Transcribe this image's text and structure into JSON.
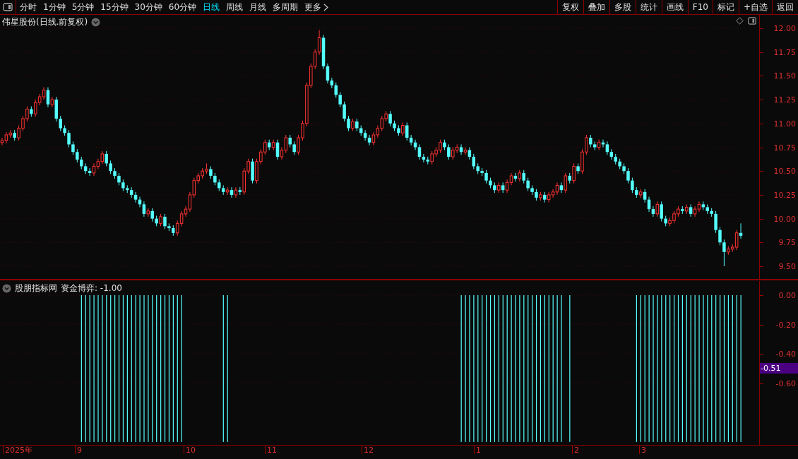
{
  "toolbar": {
    "periods": [
      {
        "label": "分时",
        "selected": false
      },
      {
        "label": "1分钟",
        "selected": false
      },
      {
        "label": "5分钟",
        "selected": false
      },
      {
        "label": "15分钟",
        "selected": false
      },
      {
        "label": "30分钟",
        "selected": false
      },
      {
        "label": "60分钟",
        "selected": false
      },
      {
        "label": "日线",
        "selected": true
      },
      {
        "label": "周线",
        "selected": false
      },
      {
        "label": "月线",
        "selected": false
      },
      {
        "label": "多周期",
        "selected": false
      }
    ],
    "more": "更多",
    "actions": [
      "复权",
      "叠加",
      "多股",
      "统计",
      "画线",
      "F10",
      "标记",
      "+自选",
      "返回"
    ]
  },
  "main_chart": {
    "title": "伟星股份(日线.前复权)",
    "chart_data": {
      "type": "candlestick",
      "grid": true,
      "ylim": [
        9.5,
        12
      ],
      "yticks": [
        {
          "value": 12,
          "label": "12.00"
        },
        {
          "value": 11.75,
          "label": "11.75"
        },
        {
          "value": 11.5,
          "label": "11.50"
        },
        {
          "value": 11.25,
          "label": "11.25"
        },
        {
          "value": 11,
          "label": "11.00"
        },
        {
          "value": 10.75,
          "label": "10.75"
        },
        {
          "value": 10.5,
          "label": "10.50"
        },
        {
          "value": 10.25,
          "label": "10.25"
        },
        {
          "value": 10,
          "label": "10.00"
        },
        {
          "value": 9.75,
          "label": "9.75"
        },
        {
          "value": 9.5,
          "label": "9.50"
        }
      ],
      "ohlc": [
        [
          10.8,
          10.85,
          10.77,
          10.82
        ],
        [
          10.82,
          10.91,
          10.79,
          10.88
        ],
        [
          10.88,
          10.93,
          10.85,
          10.9
        ],
        [
          10.9,
          10.93,
          10.82,
          10.85
        ],
        [
          10.85,
          10.98,
          10.82,
          10.95
        ],
        [
          10.95,
          11.08,
          10.92,
          11.05
        ],
        [
          11.05,
          11.18,
          11.02,
          11.15
        ],
        [
          11.15,
          11.18,
          11.07,
          11.1
        ],
        [
          11.1,
          11.25,
          11.07,
          11.22
        ],
        [
          11.22,
          11.31,
          11.19,
          11.28
        ],
        [
          11.28,
          11.38,
          11.25,
          11.35
        ],
        [
          11.35,
          11.38,
          11.17,
          11.2
        ],
        [
          11.2,
          11.28,
          11.17,
          11.25
        ],
        [
          11.25,
          11.28,
          11.02,
          11.05
        ],
        [
          11.05,
          11.08,
          10.92,
          10.95
        ],
        [
          10.95,
          10.98,
          10.87,
          10.9
        ],
        [
          10.9,
          10.93,
          10.75,
          10.78
        ],
        [
          10.78,
          10.81,
          10.67,
          10.7
        ],
        [
          10.7,
          10.73,
          10.59,
          10.62
        ],
        [
          10.62,
          10.65,
          10.52,
          10.55
        ],
        [
          10.55,
          10.58,
          10.47,
          10.5
        ],
        [
          10.5,
          10.53,
          10.45,
          10.48
        ],
        [
          10.48,
          10.58,
          10.45,
          10.55
        ],
        [
          10.55,
          10.63,
          10.52,
          10.6
        ],
        [
          10.6,
          10.71,
          10.57,
          10.68
        ],
        [
          10.68,
          10.71,
          10.55,
          10.58
        ],
        [
          10.58,
          10.61,
          10.47,
          10.5
        ],
        [
          10.5,
          10.53,
          10.42,
          10.45
        ],
        [
          10.45,
          10.48,
          10.35,
          10.38
        ],
        [
          10.38,
          10.41,
          10.29,
          10.32
        ],
        [
          10.32,
          10.35,
          10.27,
          10.3
        ],
        [
          10.3,
          10.33,
          10.22,
          10.25
        ],
        [
          10.25,
          10.28,
          10.17,
          10.2
        ],
        [
          10.2,
          10.23,
          10.12,
          10.15
        ],
        [
          10.15,
          10.18,
          10.02,
          10.05
        ],
        [
          10.05,
          10.11,
          10.02,
          10.08
        ],
        [
          10.08,
          10.11,
          9.97,
          10.0
        ],
        [
          10.0,
          10.03,
          9.92,
          9.95
        ],
        [
          9.95,
          10.05,
          9.92,
          10.02
        ],
        [
          10.02,
          10.05,
          9.89,
          9.92
        ],
        [
          9.92,
          9.95,
          9.87,
          9.9
        ],
        [
          9.9,
          9.93,
          9.82,
          9.85
        ],
        [
          9.85,
          9.98,
          9.82,
          9.95
        ],
        [
          9.95,
          10.08,
          9.92,
          10.05
        ],
        [
          10.05,
          10.13,
          10.02,
          10.1
        ],
        [
          10.1,
          10.28,
          10.07,
          10.25
        ],
        [
          10.25,
          10.43,
          10.22,
          10.4
        ],
        [
          10.4,
          10.48,
          10.37,
          10.45
        ],
        [
          10.45,
          10.53,
          10.42,
          10.5
        ],
        [
          10.5,
          10.58,
          10.47,
          10.52
        ],
        [
          10.52,
          10.55,
          10.42,
          10.45
        ],
        [
          10.45,
          10.48,
          10.35,
          10.38
        ],
        [
          10.38,
          10.41,
          10.29,
          10.32
        ],
        [
          10.32,
          10.35,
          10.25,
          10.28
        ],
        [
          10.28,
          10.33,
          10.25,
          10.3
        ],
        [
          10.3,
          10.33,
          10.22,
          10.25
        ],
        [
          10.25,
          10.33,
          10.22,
          10.3
        ],
        [
          10.3,
          10.33,
          10.25,
          10.28
        ],
        [
          10.28,
          10.53,
          10.25,
          10.5
        ],
        [
          10.5,
          10.63,
          10.47,
          10.6
        ],
        [
          10.6,
          10.63,
          10.37,
          10.4
        ],
        [
          10.4,
          10.63,
          10.37,
          10.6
        ],
        [
          10.6,
          10.73,
          10.57,
          10.7
        ],
        [
          10.7,
          10.83,
          10.67,
          10.8
        ],
        [
          10.8,
          10.83,
          10.72,
          10.75
        ],
        [
          10.75,
          10.83,
          10.72,
          10.8
        ],
        [
          10.8,
          10.83,
          10.62,
          10.65
        ],
        [
          10.65,
          10.75,
          10.62,
          10.72
        ],
        [
          10.72,
          10.88,
          10.69,
          10.85
        ],
        [
          10.85,
          10.88,
          10.75,
          10.78
        ],
        [
          10.78,
          10.81,
          10.67,
          10.7
        ],
        [
          10.7,
          10.88,
          10.67,
          10.85
        ],
        [
          10.85,
          11.03,
          10.82,
          11.0
        ],
        [
          11.0,
          11.43,
          10.97,
          11.4
        ],
        [
          11.4,
          11.63,
          11.37,
          11.6
        ],
        [
          11.6,
          11.78,
          11.57,
          11.75
        ],
        [
          11.75,
          11.98,
          11.72,
          11.9
        ],
        [
          11.9,
          11.93,
          11.57,
          11.6
        ],
        [
          11.6,
          11.63,
          11.42,
          11.45
        ],
        [
          11.45,
          11.48,
          11.37,
          11.4
        ],
        [
          11.4,
          11.43,
          11.27,
          11.3
        ],
        [
          11.3,
          11.33,
          11.17,
          11.2
        ],
        [
          11.2,
          11.23,
          11.02,
          11.05
        ],
        [
          11.05,
          11.08,
          10.92,
          10.95
        ],
        [
          10.95,
          11.05,
          10.92,
          11.02
        ],
        [
          11.02,
          11.05,
          10.92,
          10.95
        ],
        [
          10.95,
          10.98,
          10.87,
          10.9
        ],
        [
          10.9,
          10.93,
          10.82,
          10.85
        ],
        [
          10.85,
          10.88,
          10.77,
          10.8
        ],
        [
          10.8,
          10.91,
          10.77,
          10.88
        ],
        [
          10.88,
          10.98,
          10.85,
          10.95
        ],
        [
          10.95,
          11.08,
          10.92,
          11.05
        ],
        [
          11.05,
          11.13,
          11.02,
          11.1
        ],
        [
          11.1,
          11.13,
          10.97,
          11.0
        ],
        [
          11.0,
          11.03,
          10.92,
          10.95
        ],
        [
          10.95,
          10.98,
          10.87,
          10.9
        ],
        [
          10.9,
          11.01,
          10.87,
          10.98
        ],
        [
          10.98,
          11.01,
          10.82,
          10.85
        ],
        [
          10.85,
          10.88,
          10.77,
          10.8
        ],
        [
          10.8,
          10.83,
          10.72,
          10.75
        ],
        [
          10.75,
          10.78,
          10.62,
          10.65
        ],
        [
          10.65,
          10.68,
          10.59,
          10.62
        ],
        [
          10.62,
          10.65,
          10.57,
          10.6
        ],
        [
          10.6,
          10.71,
          10.57,
          10.68
        ],
        [
          10.68,
          10.75,
          10.65,
          10.72
        ],
        [
          10.72,
          10.83,
          10.69,
          10.8
        ],
        [
          10.8,
          10.83,
          10.72,
          10.75
        ],
        [
          10.75,
          10.78,
          10.62,
          10.65
        ],
        [
          10.65,
          10.75,
          10.62,
          10.72
        ],
        [
          10.72,
          10.78,
          10.69,
          10.75
        ],
        [
          10.75,
          10.78,
          10.67,
          10.7
        ],
        [
          10.7,
          10.75,
          10.67,
          10.72
        ],
        [
          10.72,
          10.75,
          10.62,
          10.65
        ],
        [
          10.65,
          10.68,
          10.52,
          10.55
        ],
        [
          10.55,
          10.58,
          10.47,
          10.5
        ],
        [
          10.5,
          10.53,
          10.45,
          10.48
        ],
        [
          10.48,
          10.51,
          10.37,
          10.4
        ],
        [
          10.4,
          10.43,
          10.32,
          10.35
        ],
        [
          10.35,
          10.38,
          10.27,
          10.3
        ],
        [
          10.3,
          10.38,
          10.27,
          10.35
        ],
        [
          10.35,
          10.38,
          10.27,
          10.3
        ],
        [
          10.3,
          10.41,
          10.27,
          10.38
        ],
        [
          10.38,
          10.48,
          10.35,
          10.45
        ],
        [
          10.45,
          10.48,
          10.39,
          10.42
        ],
        [
          10.42,
          10.51,
          10.39,
          10.48
        ],
        [
          10.48,
          10.51,
          10.37,
          10.4
        ],
        [
          10.4,
          10.43,
          10.29,
          10.32
        ],
        [
          10.32,
          10.35,
          10.25,
          10.28
        ],
        [
          10.28,
          10.31,
          10.19,
          10.22
        ],
        [
          10.22,
          10.28,
          10.19,
          10.25
        ],
        [
          10.25,
          10.28,
          10.17,
          10.2
        ],
        [
          10.2,
          10.28,
          10.17,
          10.25
        ],
        [
          10.25,
          10.31,
          10.22,
          10.28
        ],
        [
          10.28,
          10.38,
          10.25,
          10.35
        ],
        [
          10.35,
          10.38,
          10.27,
          10.3
        ],
        [
          10.3,
          10.48,
          10.27,
          10.45
        ],
        [
          10.45,
          10.48,
          10.37,
          10.4
        ],
        [
          10.4,
          10.58,
          10.37,
          10.55
        ],
        [
          10.55,
          10.58,
          10.47,
          10.5
        ],
        [
          10.5,
          10.73,
          10.47,
          10.7
        ],
        [
          10.7,
          10.88,
          10.67,
          10.85
        ],
        [
          10.85,
          10.88,
          10.75,
          10.78
        ],
        [
          10.78,
          10.81,
          10.72,
          10.75
        ],
        [
          10.75,
          10.83,
          10.72,
          10.8
        ],
        [
          10.8,
          10.83,
          10.75,
          10.78
        ],
        [
          10.78,
          10.81,
          10.67,
          10.7
        ],
        [
          10.7,
          10.73,
          10.62,
          10.65
        ],
        [
          10.65,
          10.68,
          10.57,
          10.6
        ],
        [
          10.6,
          10.63,
          10.52,
          10.55
        ],
        [
          10.55,
          10.58,
          10.47,
          10.5
        ],
        [
          10.5,
          10.53,
          10.37,
          10.4
        ],
        [
          10.4,
          10.43,
          10.27,
          10.3
        ],
        [
          10.3,
          10.33,
          10.22,
          10.25
        ],
        [
          10.25,
          10.31,
          10.22,
          10.28
        ],
        [
          10.28,
          10.31,
          10.17,
          10.2
        ],
        [
          10.2,
          10.23,
          10.07,
          10.1
        ],
        [
          10.1,
          10.13,
          10.02,
          10.05
        ],
        [
          10.05,
          10.18,
          10.02,
          10.15
        ],
        [
          10.15,
          10.18,
          9.97,
          10.0
        ],
        [
          10.0,
          10.03,
          9.92,
          9.95
        ],
        [
          9.95,
          10.01,
          9.92,
          9.98
        ],
        [
          9.98,
          10.08,
          9.95,
          10.05
        ],
        [
          10.05,
          10.13,
          10.02,
          10.1
        ],
        [
          10.1,
          10.13,
          10.05,
          10.08
        ],
        [
          10.08,
          10.15,
          10.05,
          10.12
        ],
        [
          10.12,
          10.15,
          10.02,
          10.05
        ],
        [
          10.05,
          10.13,
          10.02,
          10.1
        ],
        [
          10.1,
          10.18,
          10.07,
          10.15
        ],
        [
          10.15,
          10.18,
          10.09,
          10.12
        ],
        [
          10.12,
          10.15,
          10.05,
          10.08
        ],
        [
          10.08,
          10.11,
          10.02,
          10.05
        ],
        [
          10.05,
          10.08,
          9.85,
          9.88
        ],
        [
          9.88,
          9.91,
          9.72,
          9.75
        ],
        [
          9.75,
          9.78,
          9.5,
          9.65
        ],
        [
          9.65,
          9.71,
          9.62,
          9.68
        ],
        [
          9.68,
          9.73,
          9.65,
          9.7
        ],
        [
          9.7,
          9.88,
          9.67,
          9.85
        ],
        [
          9.85,
          9.95,
          9.79,
          9.82
        ]
      ]
    }
  },
  "indicator": {
    "title": "股朋指标网",
    "reading": ": -1.00",
    "current_reading": "-0.51",
    "chart_data": {
      "type": "bar",
      "grid": true,
      "ylim": [
        -1.02,
        0
      ],
      "yticks": [
        {
          "value": 0,
          "label": "0.00"
        },
        {
          "value": -0.2,
          "label": "-0.20"
        },
        {
          "value": -0.4,
          "label": "-0.40"
        },
        {
          "value": -0.6,
          "label": "-0.60"
        }
      ],
      "series": [
        {
          "name": "资金博弈",
          "color": "#54ffff",
          "values": [
            null,
            null,
            null,
            null,
            null,
            null,
            null,
            null,
            null,
            null,
            null,
            null,
            null,
            null,
            null,
            null,
            null,
            null,
            null,
            -1,
            -1,
            -1,
            -1,
            -1,
            -1,
            -1,
            -1,
            -1,
            -1,
            -1,
            -1,
            -1,
            -1,
            -1,
            -1,
            -1,
            -1,
            -1,
            -1,
            -1,
            -1,
            -1,
            -1,
            -1,
            null,
            null,
            null,
            null,
            null,
            null,
            null,
            null,
            null,
            -1,
            -1,
            null,
            null,
            null,
            null,
            null,
            null,
            null,
            null,
            null,
            null,
            null,
            null,
            null,
            null,
            null,
            null,
            null,
            null,
            null,
            null,
            null,
            null,
            null,
            null,
            null,
            null,
            null,
            null,
            null,
            null,
            null,
            null,
            null,
            null,
            null,
            null,
            null,
            null,
            null,
            null,
            null,
            null,
            null,
            null,
            null,
            null,
            null,
            null,
            null,
            null,
            null,
            null,
            null,
            null,
            null,
            -1,
            -1,
            -1,
            -1,
            -1,
            -1,
            -1,
            -1,
            -1,
            -1,
            -1,
            -1,
            -1,
            -1,
            -1,
            -1,
            -1,
            -1,
            -1,
            -1,
            -1,
            -1,
            -1,
            -1,
            -1,
            null,
            -1,
            null,
            null,
            null,
            null,
            null,
            null,
            null,
            null,
            null,
            null,
            null,
            null,
            null,
            null,
            null,
            -1,
            -1,
            -1,
            -1,
            -1,
            -1,
            -1,
            -1,
            -1,
            -1,
            -1,
            -1,
            -1,
            -1,
            -1,
            -1,
            -1,
            -1,
            -1,
            -1,
            -1,
            -1,
            -1,
            -1,
            -1,
            -1
          ]
        }
      ]
    }
  },
  "time_axis": [
    "2025年",
    "9",
    "10",
    "11",
    "12",
    "1",
    "2",
    "3"
  ]
}
